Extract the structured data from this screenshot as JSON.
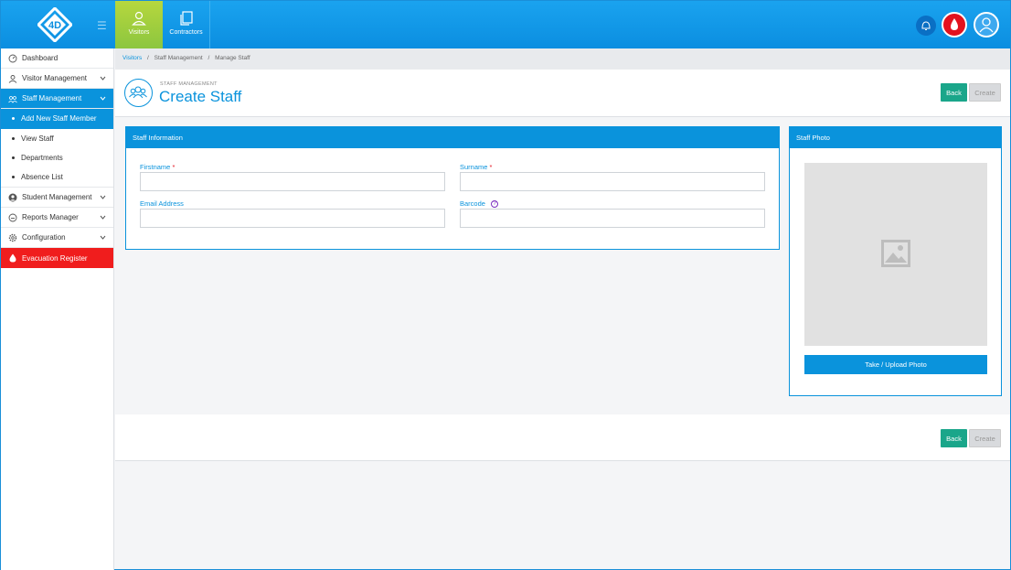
{
  "topnav": {
    "logo_text": "4D",
    "tabs": [
      {
        "label": "Visitors",
        "active": true
      },
      {
        "label": "Contractors",
        "active": false
      }
    ]
  },
  "sidebar": {
    "items": [
      {
        "label": "Dashboard",
        "icon": "dashboard-icon"
      },
      {
        "label": "Visitor Management",
        "icon": "person-icon",
        "chevron": true
      },
      {
        "label": "Staff Management",
        "icon": "staff-icon",
        "chevron": true,
        "active": true
      },
      {
        "label": "Add New Staff Member",
        "sub": true,
        "active": true
      },
      {
        "label": "View Staff",
        "sub": true
      },
      {
        "label": "Departments",
        "sub": true
      },
      {
        "label": "Absence List",
        "sub": true
      },
      {
        "label": "Student Management",
        "icon": "student-icon",
        "chevron": true
      },
      {
        "label": "Reports Manager",
        "icon": "reports-icon",
        "chevron": true
      },
      {
        "label": "Configuration",
        "icon": "gear-icon",
        "chevron": true
      },
      {
        "label": "Evacuation Register",
        "icon": "fire-icon"
      }
    ]
  },
  "breadcrumb": [
    "Visitors",
    "Staff Management",
    "Manage Staff"
  ],
  "header": {
    "section": "STAFF MANAGEMENT",
    "title": "Create Staff",
    "back_label": "Back",
    "create_label": "Create"
  },
  "staff_info": {
    "title": "Staff Information",
    "firstname_label": "Firstname",
    "surname_label": "Surname",
    "email_label": "Email Address",
    "barcode_label": "Barcode",
    "required_mark": "*",
    "help_mark": "?",
    "firstname_value": "",
    "surname_value": "",
    "email_value": "",
    "barcode_value": ""
  },
  "staff_photo": {
    "title": "Staff Photo",
    "upload_label": "Take / Upload Photo"
  },
  "footer": {
    "back_label": "Back",
    "create_label": "Create"
  },
  "colors": {
    "primary": "#0a93dc",
    "back_button": "#1aa68a",
    "evacuation": "#f01d1d",
    "visitors_tab": "#8cc63f"
  }
}
